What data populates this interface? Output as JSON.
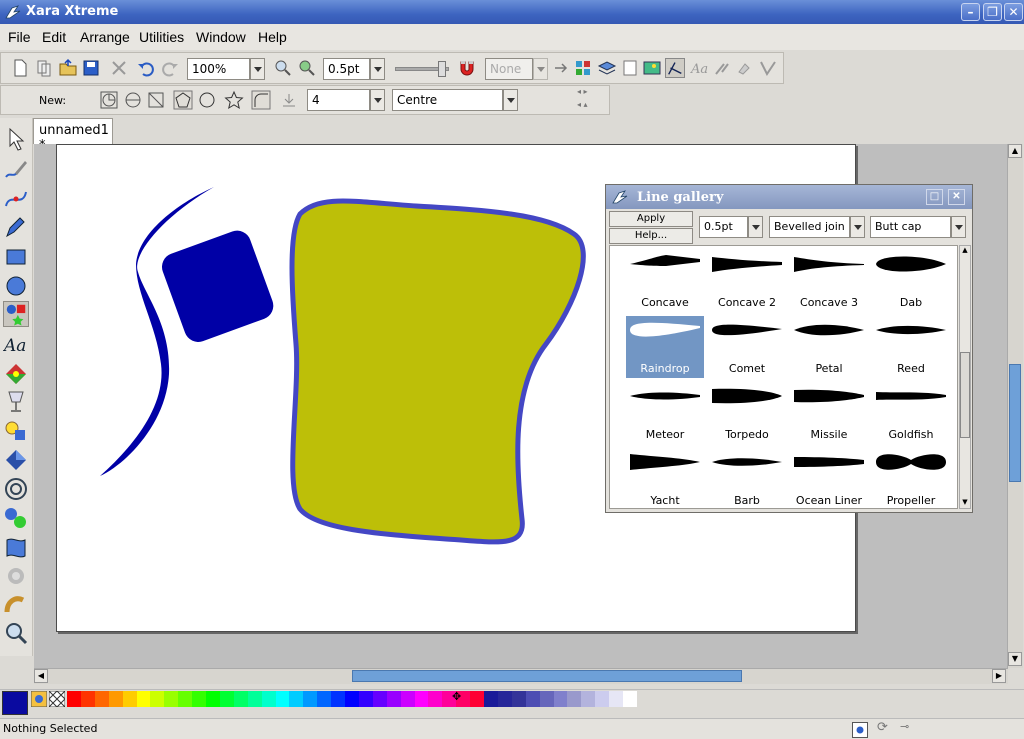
{
  "window": {
    "title": "Xara Xtreme"
  },
  "menu": [
    "File",
    "Edit",
    "Arrange",
    "Utilities",
    "Window",
    "Help"
  ],
  "toolbar": {
    "zoom": "100%",
    "line_width": "0.5pt",
    "snap": "None"
  },
  "infobar": {
    "new_label": "New:",
    "sides": "4",
    "align": "Centre"
  },
  "document": {
    "tab": "unnamed1 *"
  },
  "gallery": {
    "title": "Line gallery",
    "apply": "Apply",
    "help": "Help...",
    "width": "0.5pt",
    "join": "Bevelled join",
    "cap": "Butt cap",
    "items": [
      {
        "label": "Concave",
        "shape": "concave"
      },
      {
        "label": "Concave 2",
        "shape": "concave2"
      },
      {
        "label": "Concave 3",
        "shape": "concave3"
      },
      {
        "label": "Dab",
        "shape": "dab"
      },
      {
        "label": "Raindrop",
        "shape": "raindrop",
        "selected": true
      },
      {
        "label": "Comet",
        "shape": "comet"
      },
      {
        "label": "Petal",
        "shape": "petal"
      },
      {
        "label": "Reed",
        "shape": "reed"
      },
      {
        "label": "Meteor",
        "shape": "meteor"
      },
      {
        "label": "Torpedo",
        "shape": "torpedo"
      },
      {
        "label": "Missile",
        "shape": "missile"
      },
      {
        "label": "Goldfish",
        "shape": "goldfish"
      },
      {
        "label": "Yacht",
        "shape": "yacht"
      },
      {
        "label": "Barb",
        "shape": "barb"
      },
      {
        "label": "Ocean Liner",
        "shape": "oceanliner"
      },
      {
        "label": "Propeller",
        "shape": "propeller"
      }
    ]
  },
  "status": {
    "text": "Nothing Selected"
  },
  "colors": {
    "current": "#0a0aa0",
    "palette": [
      "#ff0000",
      "#ff3300",
      "#ff6600",
      "#ff9900",
      "#ffcc00",
      "#ffff00",
      "#ccff00",
      "#99ff00",
      "#66ff00",
      "#33ff00",
      "#00ff00",
      "#00ff33",
      "#00ff66",
      "#00ff99",
      "#00ffcc",
      "#00ffff",
      "#00ccff",
      "#0099ff",
      "#0066ff",
      "#0033ff",
      "#0000ff",
      "#3300ff",
      "#6600ff",
      "#9900ff",
      "#cc00ff",
      "#ff00ff",
      "#ff00cc",
      "#ff0099",
      "#ff0066",
      "#ff0033",
      "#1a1a99",
      "#262699",
      "#333399",
      "#4d4db3",
      "#6666bb",
      "#8080cc",
      "#9999cc",
      "#b3b3dd",
      "#ccccee",
      "#e6e6f5",
      "#ffffff"
    ],
    "shape_fill": "#bdbf08",
    "shape_stroke": "#4447c4",
    "blue_shapes": "#0000a6"
  }
}
